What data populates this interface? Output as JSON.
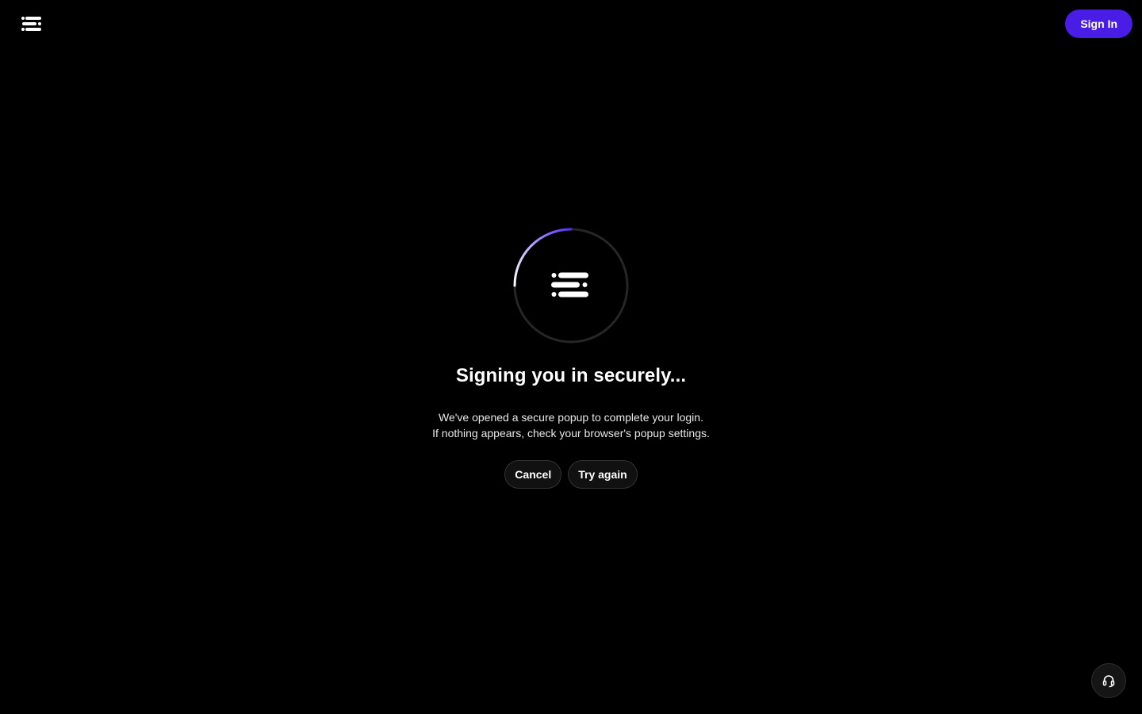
{
  "header": {
    "logo_icon": "menu-lines-logo-icon",
    "signin_label": "Sign In",
    "accent_color": "#4a1de6"
  },
  "main": {
    "loader_icon": "menu-lines-logo-icon",
    "title": "Signing you in securely...",
    "description_line1": "We've opened a secure popup to complete your login.",
    "description_line2": "If nothing appears, check your browser's popup settings.",
    "cancel_label": "Cancel",
    "try_again_label": "Try again"
  },
  "support": {
    "icon": "headset-icon"
  }
}
